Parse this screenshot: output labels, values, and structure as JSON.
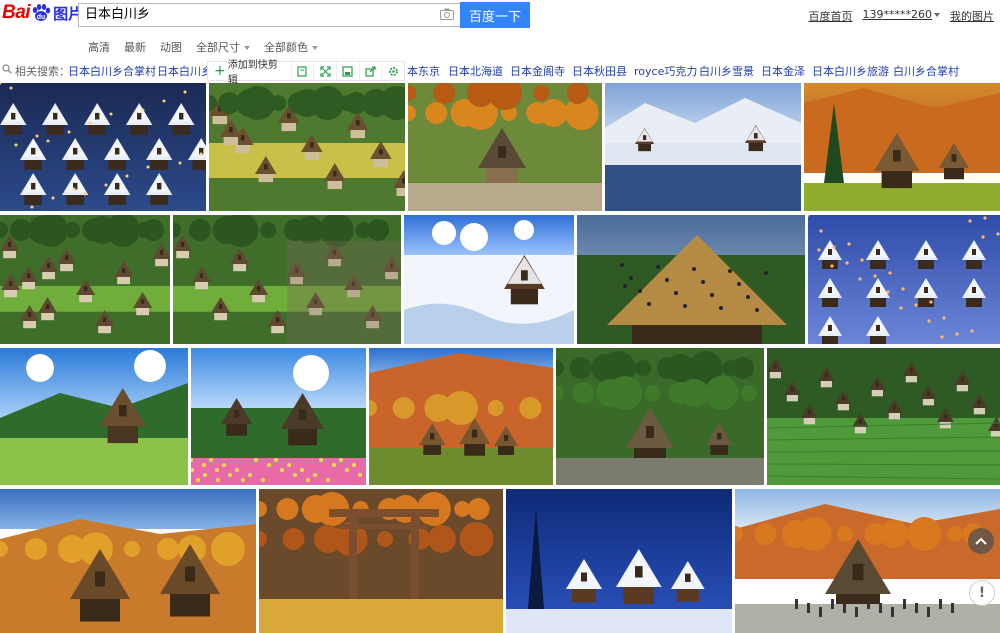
{
  "header": {
    "logo": {
      "part1": "Bai",
      "part2": "du",
      "part3": "图片"
    },
    "search_query": "日本白川乡",
    "search_button": "百度一下",
    "links": {
      "home": "百度首页",
      "user": "139*****260",
      "my_images": "我的图片"
    }
  },
  "filters": [
    {
      "label": "高清",
      "dropdown": false
    },
    {
      "label": "最新",
      "dropdown": false
    },
    {
      "label": "动图",
      "dropdown": false
    },
    {
      "label": "全部尺寸",
      "dropdown": true
    },
    {
      "label": "全部颜色",
      "dropdown": true
    }
  ],
  "related": {
    "label": "相关搜索：",
    "items": [
      "日本白川乡合掌村",
      "日本白川乡地",
      "本东京",
      "日本北海道",
      "日本金阁寺",
      "日本秋田县",
      "royce巧克力",
      "白川乡雪景",
      "日本金泽",
      "日本白川乡旅游",
      "白川乡合掌村"
    ]
  },
  "image_toolbar": {
    "add_label": "添加到快剪辑",
    "icons": [
      "clip-icon",
      "expand-icon",
      "save-icon",
      "share-icon",
      "settings-icon"
    ]
  },
  "images": [
    {
      "scene": "snow-village-night"
    },
    {
      "scene": "green-village-aerial"
    },
    {
      "scene": "autumn-street"
    },
    {
      "scene": "lake-reflection-winter"
    },
    {
      "scene": "autumn-farmhouse"
    },
    {
      "scene": "village-summer"
    },
    {
      "scene": "village-summer-2"
    },
    {
      "scene": "snow-river-house"
    },
    {
      "scene": "thatched-roof-repair"
    },
    {
      "scene": "snow-village-lights"
    },
    {
      "scene": "blue-sky-village"
    },
    {
      "scene": "flower-farmhouse"
    },
    {
      "scene": "autumn-hill-houses"
    },
    {
      "scene": "forest-houses"
    },
    {
      "scene": "village-field-aerial"
    },
    {
      "scene": "autumn-gassho-houses"
    },
    {
      "scene": "torii-shrine-autumn"
    },
    {
      "scene": "snow-houses-blue-night"
    },
    {
      "scene": "autumn-visitors"
    }
  ],
  "colors": {
    "brand_red": "#e10601",
    "brand_blue": "#2932e1",
    "button": "#3385ff",
    "related_link": "#2440b3"
  }
}
